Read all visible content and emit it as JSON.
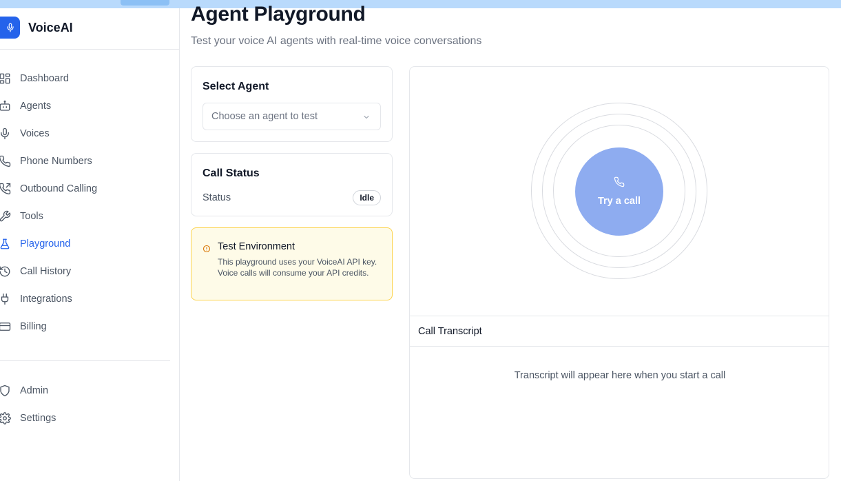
{
  "app": {
    "name": "VoiceAI"
  },
  "sidebar": {
    "items": [
      {
        "label": "Dashboard",
        "icon": "dashboard-icon"
      },
      {
        "label": "Agents",
        "icon": "bot-icon"
      },
      {
        "label": "Voices",
        "icon": "mic-icon"
      },
      {
        "label": "Phone Numbers",
        "icon": "phone-icon"
      },
      {
        "label": "Outbound Calling",
        "icon": "phone-outgoing-icon"
      },
      {
        "label": "Tools",
        "icon": "wrench-icon"
      },
      {
        "label": "Playground",
        "icon": "flask-icon",
        "active": true
      },
      {
        "label": "Call History",
        "icon": "history-icon"
      },
      {
        "label": "Integrations",
        "icon": "plug-icon"
      },
      {
        "label": "Billing",
        "icon": "credit-card-icon"
      }
    ],
    "bottom_items": [
      {
        "label": "Admin",
        "icon": "shield-icon"
      },
      {
        "label": "Settings",
        "icon": "gear-icon"
      }
    ]
  },
  "page": {
    "title": "Agent Playground",
    "subtitle": "Test your voice AI agents with real-time voice conversations"
  },
  "select_agent": {
    "title": "Select Agent",
    "placeholder": "Choose an agent to test"
  },
  "call_status": {
    "title": "Call Status",
    "label": "Status",
    "value": "Idle"
  },
  "test_environment": {
    "title": "Test Environment",
    "text": "This playground uses your VoiceAI API key. Voice calls will consume your API credits."
  },
  "call": {
    "button_label": "Try a call"
  },
  "transcript": {
    "title": "Call Transcript",
    "empty_text": "Transcript will appear here when you start a call"
  },
  "colors": {
    "brand": "#2563eb",
    "call_button": "#8eacf0",
    "warning_bg": "#fefbe8",
    "warning_border": "#fcd34d"
  }
}
